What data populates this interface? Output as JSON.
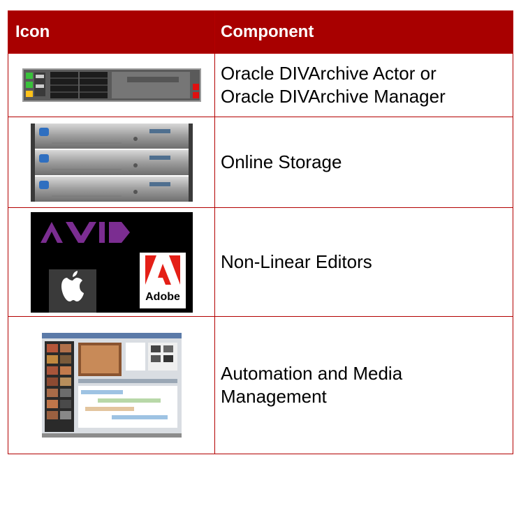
{
  "table": {
    "header": {
      "icon": "Icon",
      "component": "Component"
    },
    "rows": [
      {
        "icon": "server-rack-icon",
        "lines": [
          "Oracle DIVArchive Actor or",
          "Oracle DIVArchive Manager"
        ]
      },
      {
        "icon": "storage-array-icon",
        "lines": [
          "Online Storage"
        ]
      },
      {
        "icon": "nle-logos-icon",
        "logo_text": "Adobe",
        "lines": [
          "Non-Linear Editors"
        ]
      },
      {
        "icon": "media-software-screenshot-icon",
        "lines": [
          "Automation and Media",
          "Management"
        ]
      }
    ]
  },
  "colors": {
    "header_bg": "#a80000",
    "border": "#b30000",
    "avid_purple": "#7b2d91",
    "adobe_red": "#e41f17"
  }
}
